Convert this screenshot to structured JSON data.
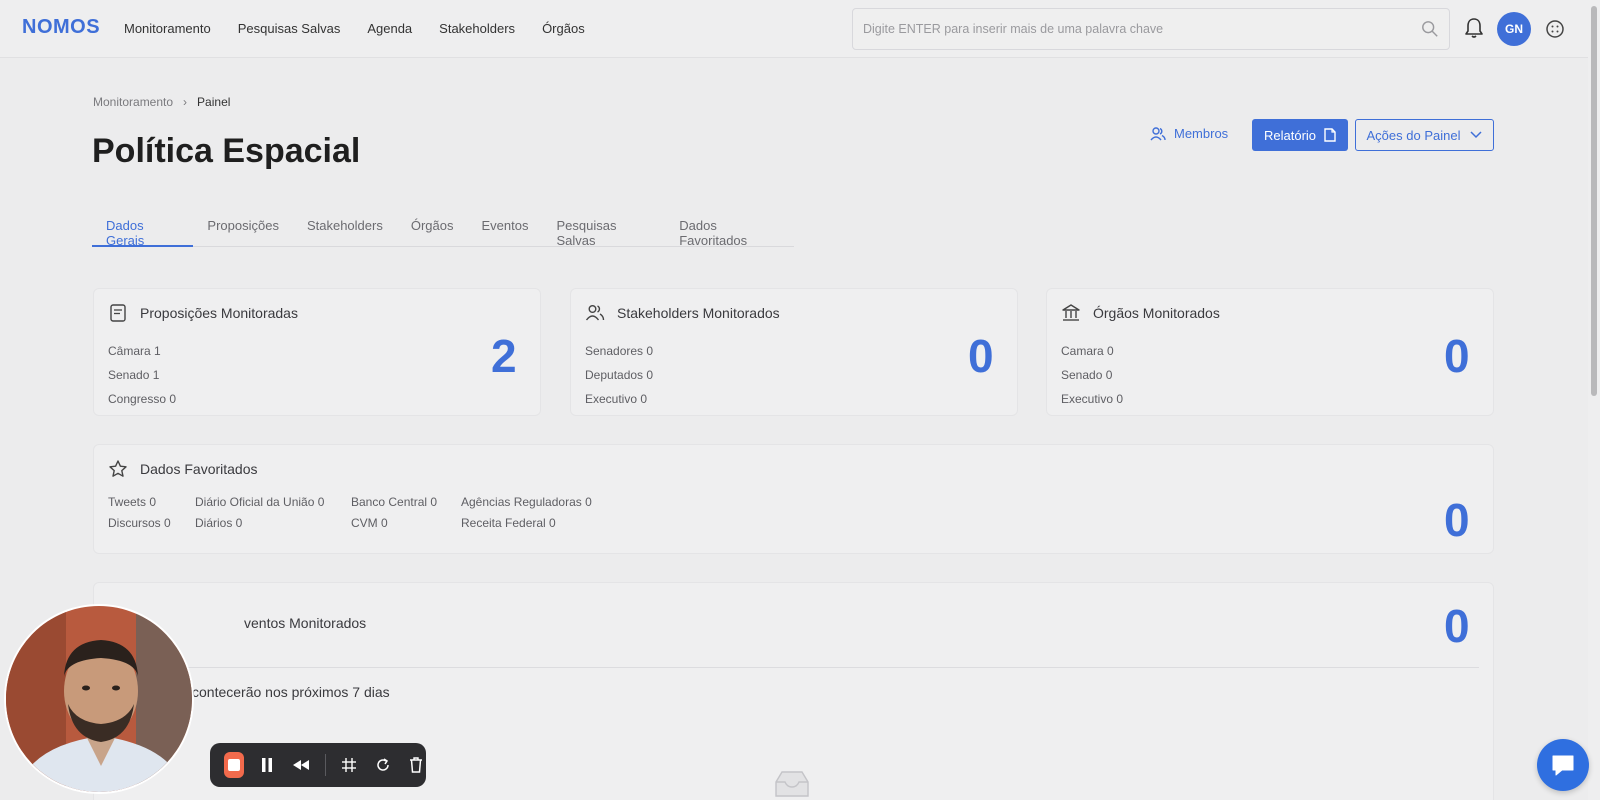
{
  "app": {
    "logo": "NOMOS",
    "user_initials": "GN"
  },
  "nav": {
    "items": [
      "Monitoramento",
      "Pesquisas Salvas",
      "Agenda",
      "Stakeholders",
      "Órgãos"
    ]
  },
  "search": {
    "placeholder": "Digite ENTER para inserir mais de uma palavra chave"
  },
  "breadcrumb": {
    "parent": "Monitoramento",
    "current": "Painel"
  },
  "page": {
    "title": "Política Espacial"
  },
  "actions": {
    "members": "Membros",
    "report": "Relatório",
    "panel_actions": "Ações do Painel"
  },
  "tabs": [
    "Dados Gerais",
    "Proposições",
    "Stakeholders",
    "Órgãos",
    "Eventos",
    "Pesquisas Salvas",
    "Dados Favoritados"
  ],
  "cards": {
    "proposicoes": {
      "title": "Proposições Monitoradas",
      "rows": [
        "Câmara  1",
        "Senado  1",
        "Congresso  0"
      ],
      "total": "2"
    },
    "stakeholders": {
      "title": "Stakeholders Monitorados",
      "rows": [
        "Senadores  0",
        "Deputados  0",
        "Executivo  0"
      ],
      "total": "0"
    },
    "orgaos": {
      "title": "Órgãos Monitorados",
      "rows": [
        "Camara  0",
        "Senado  0",
        "Executivo  0"
      ],
      "total": "0"
    },
    "favoritos": {
      "title": "Dados Favoritados",
      "items": [
        "Tweets 0",
        "Diário Oficial da União 0",
        "Banco Central 0",
        "Agências Reguladoras 0",
        "Discursos 0",
        "Diários 0",
        "CVM 0",
        "Receita Federal 0"
      ],
      "total": "0"
    },
    "eventos": {
      "title": "ventos Monitorados",
      "subtitle": "contecerão nos próximos 7 dias",
      "total": "0"
    }
  },
  "colors": {
    "accent": "#3f6fd8",
    "background": "#ececed",
    "record": "#f26a4c"
  }
}
